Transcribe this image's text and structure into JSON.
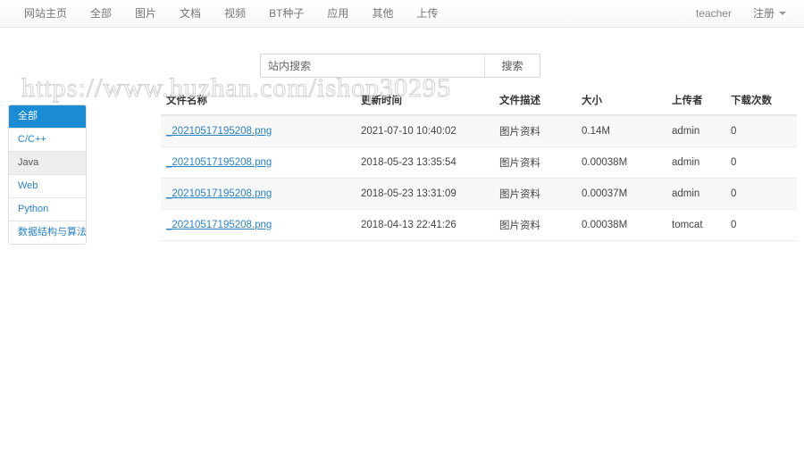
{
  "navbar": {
    "left_items": [
      {
        "label": "网站主页",
        "name": "nav-item-home"
      },
      {
        "label": "全部",
        "name": "nav-item-all"
      },
      {
        "label": "图片",
        "name": "nav-item-images"
      },
      {
        "label": "文档",
        "name": "nav-item-documents"
      },
      {
        "label": "视频",
        "name": "nav-item-videos"
      },
      {
        "label": "BT种子",
        "name": "nav-item-torrents"
      },
      {
        "label": "应用",
        "name": "nav-item-apps"
      },
      {
        "label": "其他",
        "name": "nav-item-other"
      },
      {
        "label": "上传",
        "name": "nav-item-upload"
      }
    ],
    "username": "teacher",
    "register_label": "注册"
  },
  "search": {
    "placeholder": "站内搜索",
    "value": "",
    "button_label": "搜索"
  },
  "watermark": {
    "text": "https://www.huzhan.com/ishop30295"
  },
  "sidebar": {
    "items": [
      {
        "label": "全部",
        "state": "active"
      },
      {
        "label": "C/C++",
        "state": "normal"
      },
      {
        "label": "Java",
        "state": "hover"
      },
      {
        "label": "Web",
        "state": "normal"
      },
      {
        "label": "Python",
        "state": "normal"
      },
      {
        "label": "数据结构与算法",
        "state": "normal"
      }
    ]
  },
  "table": {
    "headers": {
      "name": "文件名称",
      "time": "更新时间",
      "desc": "文件描述",
      "size": "大小",
      "uploader": "上传者",
      "downloads": "下载次数"
    },
    "rows": [
      {
        "name": "_20210517195208.png",
        "time": "2021-07-10 10:40:02",
        "desc": "图片资料",
        "size": "0.14M",
        "uploader": "admin",
        "downloads": "0"
      },
      {
        "name": "_20210517195208.png",
        "time": "2018-05-23 13:35:54",
        "desc": "图片资料",
        "size": "0.00038M",
        "uploader": "admin",
        "downloads": "0"
      },
      {
        "name": "_20210517195208.png",
        "time": "2018-05-23 13:31:09",
        "desc": "图片资料",
        "size": "0.00037M",
        "uploader": "admin",
        "downloads": "0"
      },
      {
        "name": "_20210517195208.png",
        "time": "2018-04-13 22:41:26",
        "desc": "图片资料",
        "size": "0.00038M",
        "uploader": "tomcat",
        "downloads": "0"
      }
    ]
  },
  "colors": {
    "accent_blue": "#1b8cd3",
    "link_blue": "#2a82c6",
    "nav_text": "#777777",
    "watermark_gray": "#d2d2d2"
  }
}
